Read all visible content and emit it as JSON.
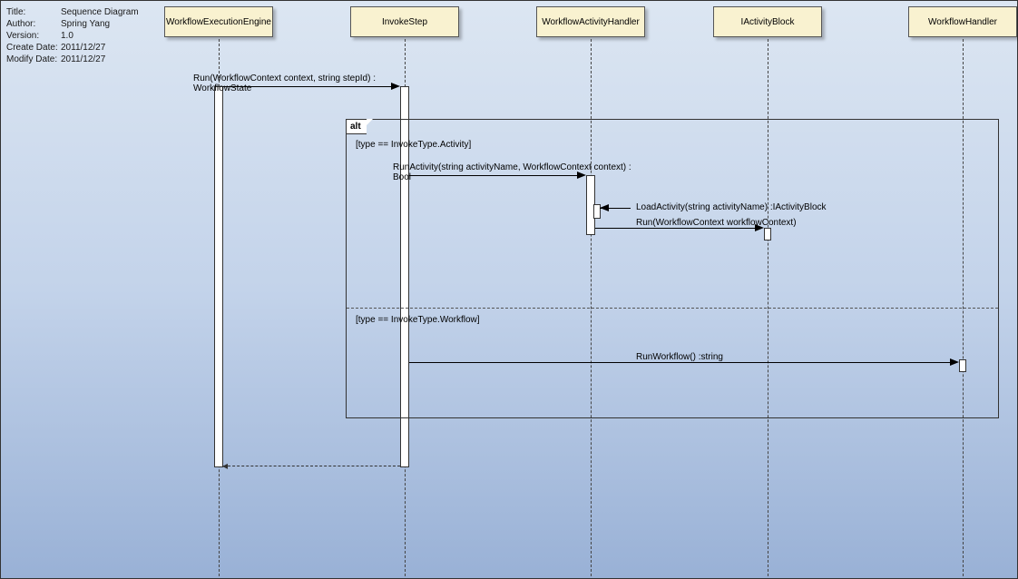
{
  "meta": {
    "title_key": "Title:",
    "title_val": "Sequence Diagram",
    "author_key": "Author:",
    "author_val": "Spring Yang",
    "version_key": "Version:",
    "version_val": "1.0",
    "create_key": "Create Date:",
    "create_val": "2011/12/27",
    "modify_key": "Modify Date:",
    "modify_val": "2011/12/27"
  },
  "lifelines": {
    "l1": "WorkflowExecutionEngine",
    "l2": "InvokeStep",
    "l3": "WorkflowActivityHandler",
    "l4": "IActivityBlock",
    "l5": "WorkflowHandler"
  },
  "fragment": {
    "operator": "alt",
    "guard1": "[type == InvokeType.Activity]",
    "guard2": "[type == InvokeType.Workflow]"
  },
  "messages": {
    "m1": "Run(WorkflowContext context, string stepId) :\nWorkflowState",
    "m2": "RunActivity(string activityName, WorkflowContext context) :\nBool",
    "m3": "LoadActivity(string activityName) :IActivityBlock",
    "m4": "Run(WorkflowContext workflowContext)",
    "m5": "RunWorkflow() :string"
  }
}
